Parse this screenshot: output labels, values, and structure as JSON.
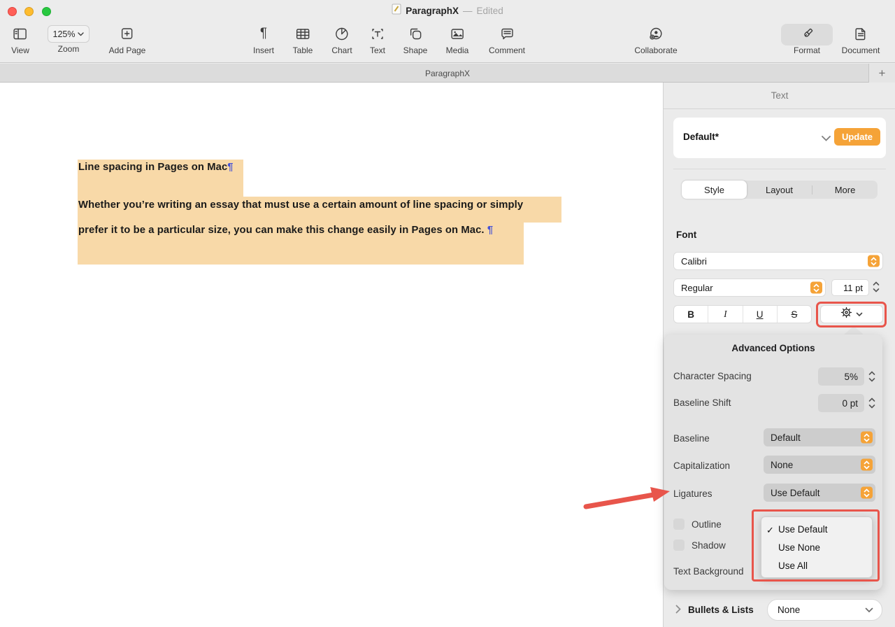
{
  "window": {
    "title": "ParagraphX",
    "dash": "—",
    "status": "Edited"
  },
  "toolbar": {
    "zoom_value": "125%",
    "items": [
      {
        "label": "View"
      },
      {
        "label": "Zoom"
      },
      {
        "label": "Add Page"
      },
      {
        "label": "Insert"
      },
      {
        "label": "Table"
      },
      {
        "label": "Chart"
      },
      {
        "label": "Text"
      },
      {
        "label": "Shape"
      },
      {
        "label": "Media"
      },
      {
        "label": "Comment"
      },
      {
        "label": "Collaborate"
      },
      {
        "label": "Format"
      },
      {
        "label": "Document"
      }
    ]
  },
  "tabbar": {
    "active_tab": "ParagraphX",
    "add_button": "+"
  },
  "document": {
    "heading": "Line spacing in Pages on Mac",
    "pilcrow": "¶",
    "body_line1": "Whether you’re writing an essay that must use a certain amount of line spacing or simply",
    "body_line2": "prefer it to be a particular size, you can make this change easily in Pages on Mac. "
  },
  "sidebar": {
    "header": "Text",
    "paragraph_style": {
      "name": "Default*",
      "update": "Update"
    },
    "tabs": [
      {
        "label": "Style"
      },
      {
        "label": "Layout"
      },
      {
        "label": "More"
      }
    ],
    "font": {
      "section_label": "Font",
      "family": "Calibri",
      "typeface": "Regular",
      "size": "11 pt",
      "bold": "B",
      "italic": "I",
      "underline": "U",
      "strikethrough": "S"
    },
    "bullets": {
      "label": "Bullets & Lists",
      "value": "None"
    }
  },
  "popover": {
    "title": "Advanced Options",
    "character_spacing": {
      "label": "Character Spacing",
      "value": "5%"
    },
    "baseline_shift": {
      "label": "Baseline Shift",
      "value": "0 pt"
    },
    "baseline": {
      "label": "Baseline",
      "value": "Default"
    },
    "capitalization": {
      "label": "Capitalization",
      "value": "None"
    },
    "ligatures": {
      "label": "Ligatures",
      "value": "Use Default"
    },
    "outline": {
      "label": "Outline"
    },
    "shadow": {
      "label": "Shadow"
    },
    "text_background": {
      "label": "Text Background"
    }
  },
  "ligatures_menu": {
    "checkmark": "✓",
    "items": [
      {
        "label": "Use Default",
        "checked": true
      },
      {
        "label": "Use None",
        "checked": false
      },
      {
        "label": "Use All",
        "checked": false
      }
    ]
  },
  "colors": {
    "accent_orange": "#F5A338",
    "annotation_red": "#E8554B",
    "highlight_peach": "#F8D9A8",
    "pilcrow_blue": "#4753D6"
  }
}
